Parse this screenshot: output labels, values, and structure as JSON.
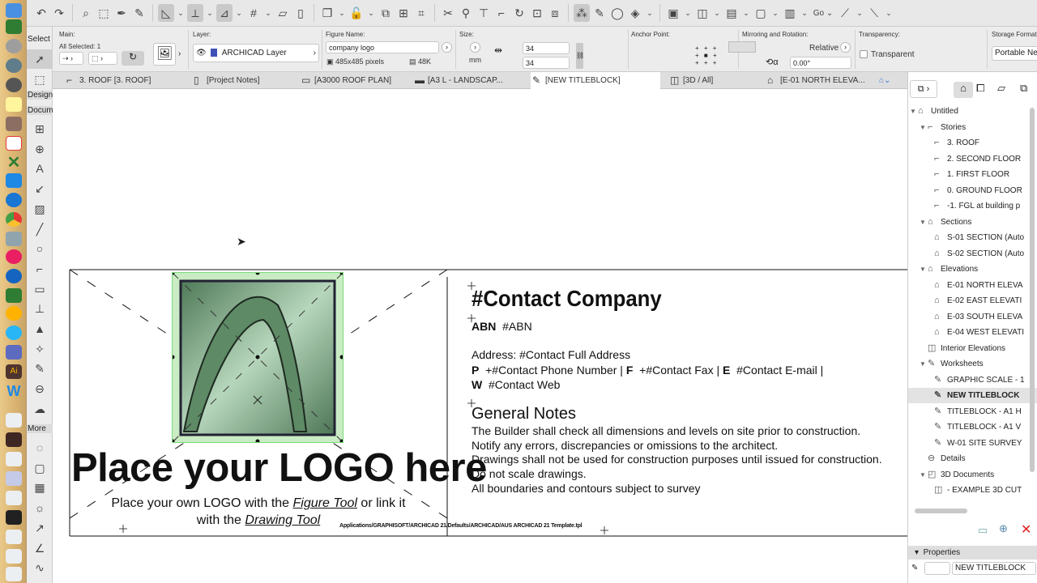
{
  "toolbar": {
    "icons": [
      "undo-icon",
      "redo-icon",
      "|",
      "find-select-icon",
      "marquee-fit-icon",
      "eyedropper-icon",
      "syringe-icon",
      "|",
      "guide-ruler-icon*",
      "dropdown",
      "snap-guide-icon*",
      "dropdown",
      "relative-construction-icon*",
      "dropdown",
      "grid-snap-icon",
      "dropdown",
      "layer-plane-icon",
      "wall-plane-icon",
      "|",
      "layer-stack-icon",
      "dropdown",
      "lock-icon",
      "dropdown",
      "group-icon",
      "dimension-icon",
      "fit-icon",
      "|",
      "scissors-icon",
      "zoom-icon",
      "align-icon",
      "resize-icon",
      "rotate-icon",
      "offset-icon",
      "drag-copy-icon",
      "|",
      "magic-wand-icon*",
      "pencil-icon",
      "circle-edit-icon",
      "paint-icon",
      "dropdown",
      "|",
      "layout-icon",
      "dropdown",
      "split-icon",
      "dropdown",
      "view-icon",
      "dropdown",
      "window-icon",
      "dropdown",
      "window2-icon",
      "dropdown"
    ],
    "go_label": "Go",
    "right_icons": [
      "arrow-tool-icon",
      "arrow-tool2-icon"
    ]
  },
  "toolbox": {
    "select_label": "Select",
    "design_label": "Design",
    "document_label": "Document",
    "more_label": "More",
    "tools": [
      "dimension-icon",
      "level-dimension-icon",
      "text-icon",
      "label-icon",
      "fill-icon",
      "line-icon",
      "circle-icon",
      "polyline-icon",
      "figure-icon",
      "elevation-dimension-icon",
      "level-icon",
      "camera-icon",
      "worksheet-icon",
      "detail-icon",
      "change-icon"
    ],
    "more_tools": [
      "marker-icon",
      "window-icon",
      "grid-icon",
      "lamp-icon",
      "radial-dimension-icon",
      "angle-dimension-icon",
      "spline-icon"
    ]
  },
  "infobox": {
    "main_label": "Main:",
    "selection_text": "All Selected: 1",
    "layer_label": "Layer:",
    "layer_value": "ARCHICAD Layer",
    "figure_name_label": "Figure Name:",
    "figure_name_value": "company logo",
    "pixels": "485x485 pixels",
    "file_size": "48K",
    "size_label": "Size:",
    "size_unit": "mm",
    "width_value": "34",
    "height_value": "34",
    "anchor_label": "Anchor Point:",
    "mirror_label": "Mirroring and Rotation:",
    "relative_label": "Relative",
    "rotation_value": "0.00°",
    "transparency_label": "Transparency:",
    "transparent_label": "Transparent",
    "transparent_checked": false,
    "storage_label": "Storage Format:",
    "storage_value": "Portable Network Graphics"
  },
  "tabs": [
    {
      "label": "3. ROOF [3. ROOF]",
      "icon": "story-icon"
    },
    {
      "label": "[Project Notes]",
      "icon": "notes-icon"
    },
    {
      "label": "[A3000 ROOF PLAN]",
      "icon": "layout-icon"
    },
    {
      "label": "[A3 L -  LANDSCAP...",
      "icon": "master-layout-icon"
    },
    {
      "label": "[NEW TITLEBLOCK]",
      "icon": "worksheet-icon",
      "active": true
    },
    {
      "label": "[3D / All]",
      "icon": "3d-icon"
    },
    {
      "label": "[E-01 NORTH ELEVA...",
      "icon": "elevation-icon"
    }
  ],
  "drawing": {
    "logo_placeholder": "Place your LOGO here",
    "logo_hint_1a": "Place your own LOGO with the ",
    "logo_hint_1b": "Figure Tool",
    "logo_hint_1c": " or link it",
    "logo_hint_2a": "with the ",
    "logo_hint_2b": "Drawing Tool",
    "template_path": "Applications/GRAPHISOFT/ARCHICAD 21/Defaults/ARCHICAD/AUS ARCHICAD 21 Template.tpl",
    "company": "#Contact Company",
    "abn_label": "ABN",
    "abn_value": "#ABN",
    "address": "Address:  #Contact Full Address",
    "p_label": "P",
    "phone": "+#Contact Phone Number | ",
    "f_label": "F",
    "fax": "+#Contact Fax | ",
    "e_label": "E",
    "email": "#Contact E-mail |",
    "w_label": "W",
    "web": "#Contact Web",
    "notes_title": "General Notes",
    "notes": [
      "The Builder shall check all dimensions and levels on site prior to construction.",
      "Notify any errors, discrepancies or omissions to the architect.",
      "Drawings shall not be used for construction purposes until issued for construction.",
      "Do not scale drawings.",
      "All boundaries and contours subject to survey"
    ]
  },
  "navigator": {
    "tree": [
      {
        "label": "Untitled",
        "level": 0,
        "icon": "project-icon",
        "expanded": true
      },
      {
        "label": "Stories",
        "level": 1,
        "icon": "stories-icon",
        "expanded": true
      },
      {
        "label": "3. ROOF",
        "level": 2,
        "icon": "story-icon"
      },
      {
        "label": "2. SECOND FLOOR",
        "level": 2,
        "icon": "story-icon"
      },
      {
        "label": "1. FIRST FLOOR",
        "level": 2,
        "icon": "story-icon"
      },
      {
        "label": "0. GROUND FLOOR",
        "level": 2,
        "icon": "story-icon"
      },
      {
        "label": "-1. FGL at building p",
        "level": 2,
        "icon": "story-icon"
      },
      {
        "label": "Sections",
        "level": 1,
        "icon": "sections-icon",
        "expanded": true
      },
      {
        "label": "S-01 SECTION (Auto",
        "level": 2,
        "icon": "section-icon"
      },
      {
        "label": "S-02 SECTION (Auto",
        "level": 2,
        "icon": "section-icon"
      },
      {
        "label": "Elevations",
        "level": 1,
        "icon": "elevations-icon",
        "expanded": true
      },
      {
        "label": "E-01 NORTH ELEVA",
        "level": 2,
        "icon": "elevation-icon"
      },
      {
        "label": "E-02 EAST ELEVATI",
        "level": 2,
        "icon": "elevation-icon"
      },
      {
        "label": "E-03 SOUTH ELEVA",
        "level": 2,
        "icon": "elevation-icon"
      },
      {
        "label": "E-04 WEST ELEVATI",
        "level": 2,
        "icon": "elevation-icon"
      },
      {
        "label": "Interior Elevations",
        "level": 1,
        "icon": "interior-elevation-icon"
      },
      {
        "label": "Worksheets",
        "level": 1,
        "icon": "worksheets-icon",
        "expanded": true
      },
      {
        "label": "GRAPHIC SCALE - 1",
        "level": 2,
        "icon": "worksheet-icon"
      },
      {
        "label": "NEW TITLEBLOCK",
        "level": 2,
        "icon": "worksheet-icon",
        "selected": true
      },
      {
        "label": "TITLEBLOCK - A1 H",
        "level": 2,
        "icon": "worksheet-icon"
      },
      {
        "label": "TITLEBLOCK - A1 V",
        "level": 2,
        "icon": "worksheet-icon"
      },
      {
        "label": "W-01 SITE SURVEY",
        "level": 2,
        "icon": "worksheet-icon"
      },
      {
        "label": "Details",
        "level": 1,
        "icon": "details-icon"
      },
      {
        "label": "3D Documents",
        "level": 1,
        "icon": "3d-documents-icon",
        "expanded": true
      },
      {
        "label": "- EXAMPLE 3D CUT",
        "level": 2,
        "icon": "3d-document-icon"
      }
    ],
    "properties_label": "Properties",
    "properties_id": "",
    "properties_name": "NEW TITLEBLOCK"
  },
  "colors": {
    "selection": "#7ddc7a",
    "logo_green": "#6f9a78",
    "close_red": "#e02020"
  }
}
